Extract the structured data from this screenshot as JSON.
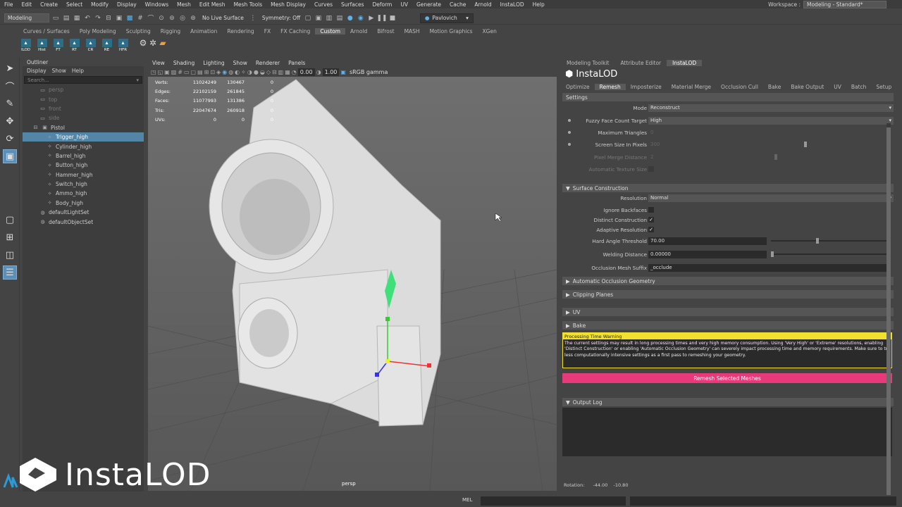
{
  "menubar": [
    "File",
    "Edit",
    "Create",
    "Select",
    "Modify",
    "Display",
    "Windows",
    "Mesh",
    "Edit Mesh",
    "Mesh Tools",
    "Mesh Display",
    "Curves",
    "Surfaces",
    "Deform",
    "UV",
    "Generate",
    "Cache",
    "Arnold",
    "InstaLOD",
    "Help"
  ],
  "workspace": {
    "label": "Workspace :",
    "value": "Modeling - Standard*"
  },
  "status": {
    "mode": "Modeling",
    "live_surface": "No Live Surface",
    "symmetry": "Symmetry: Off",
    "user": "Pavlovich"
  },
  "shelf_tabs": [
    "Curves / Surfaces",
    "Poly Modeling",
    "Sculpting",
    "Rigging",
    "Animation",
    "Rendering",
    "FX",
    "FX Caching",
    "Custom",
    "Arnold",
    "Bifrost",
    "MASH",
    "Motion Graphics",
    "XGen"
  ],
  "shelf_selected": "Custom",
  "shelf_icons": [
    "ILOD",
    "Hist",
    "FT",
    "RT",
    "CR",
    "RE",
    "HFR"
  ],
  "outliner": {
    "title": "Outliner",
    "menu": [
      "Display",
      "Show",
      "Help"
    ],
    "search_placeholder": "Search...",
    "items": [
      {
        "label": "persp",
        "dim": true,
        "indent": 1
      },
      {
        "label": "top",
        "dim": true,
        "indent": 1
      },
      {
        "label": "front",
        "dim": true,
        "indent": 1
      },
      {
        "label": "side",
        "dim": true,
        "indent": 1
      },
      {
        "label": "Pistol",
        "dim": false,
        "indent": 0
      },
      {
        "label": "Trigger_high",
        "dim": false,
        "indent": 2,
        "selected": true
      },
      {
        "label": "Cylinder_high",
        "dim": false,
        "indent": 2
      },
      {
        "label": "Barrel_high",
        "dim": false,
        "indent": 2
      },
      {
        "label": "Button_high",
        "dim": false,
        "indent": 2
      },
      {
        "label": "Hammer_high",
        "dim": false,
        "indent": 2
      },
      {
        "label": "Switch_high",
        "dim": false,
        "indent": 2
      },
      {
        "label": "Ammo_high",
        "dim": false,
        "indent": 2
      },
      {
        "label": "Body_high",
        "dim": false,
        "indent": 2
      },
      {
        "label": "defaultLightSet",
        "dim": false,
        "indent": 1
      },
      {
        "label": "defaultObjectSet",
        "dim": false,
        "indent": 1
      }
    ]
  },
  "viewport": {
    "menu": [
      "View",
      "Shading",
      "Lighting",
      "Show",
      "Renderer",
      "Panels"
    ],
    "exposure": "0.00",
    "gamma": "1.00",
    "colorspace": "sRGB gamma",
    "camera": "persp",
    "hud": [
      [
        "Verts:",
        "11024249",
        "130467",
        "0"
      ],
      [
        "Edges:",
        "22102159",
        "261845",
        "0"
      ],
      [
        "Faces:",
        "11077993",
        "131386",
        "0"
      ],
      [
        "Tris:",
        "22047674",
        "260918",
        "0"
      ],
      [
        "UVs:",
        "0",
        "0",
        "0"
      ]
    ]
  },
  "right_tabs": [
    "Modeling Toolkit",
    "Attribute Editor",
    "InstaLOD"
  ],
  "instalod": {
    "brand": "InstaLOD",
    "tabs": [
      "Optimize",
      "Remesh",
      "Imposterize",
      "Material Merge",
      "Occlusion Cull",
      "Bake",
      "Bake Output",
      "UV",
      "Batch",
      "Setup"
    ],
    "selected_tab": "Remesh",
    "settings_title": "Settings",
    "mode_label": "Mode",
    "mode_value": "Reconstruct",
    "fuzzy_label": "Fuzzy Face Count Target",
    "fuzzy_value": "High",
    "max_tri_label": "Maximum Triangles",
    "max_tri_value": "0",
    "screen_label": "Screen Size In Pixels",
    "screen_value": "300",
    "merge_label": "Pixel Merge Distance",
    "merge_value": "2",
    "autotex_label": "Automatic Texture Size",
    "surface_title": "Surface Construction",
    "res_label": "Resolution",
    "res_value": "Normal",
    "ignore_label": "Ignore Backfaces",
    "distinct_label": "Distinct Construction",
    "adaptive_label": "Adaptive Resolution",
    "hard_label": "Hard Angle Threshold",
    "hard_value": "70.00",
    "weld_label": "Welding Distance",
    "weld_value": "0.00000",
    "occl_label": "Occlusion Mesh Suffix",
    "occl_value": "_occlude",
    "sec_aog": "Automatic Occlusion Geometry",
    "sec_clip": "Clipping Planes",
    "sec_uv": "UV",
    "sec_bake": "Bake",
    "warn_title": "Processing Time Warning",
    "warn_body": "The current settings may result in long processing times and very high memory consumption. Using 'Very High' or 'Extreme' resolutions, enabling 'Distinct Construction' or enabling 'Automatic Occlusion Geometry' can severely impact processing time and memory requirements. Make sure to try less computationally intensive settings as a first pass to remeshing your geometry.",
    "remesh_button": "Remesh Selected Meshes",
    "output_log": "Output Log"
  },
  "rotation": {
    "label": "Rotation:",
    "x": "-44.00",
    "y": "-10.80"
  },
  "cmdline": {
    "lang": "MEL"
  },
  "watermark": "InstaLOD",
  "colors": {
    "accent": "#e83a7b",
    "warning": "#f2e02e",
    "selection": "#5285a6"
  }
}
